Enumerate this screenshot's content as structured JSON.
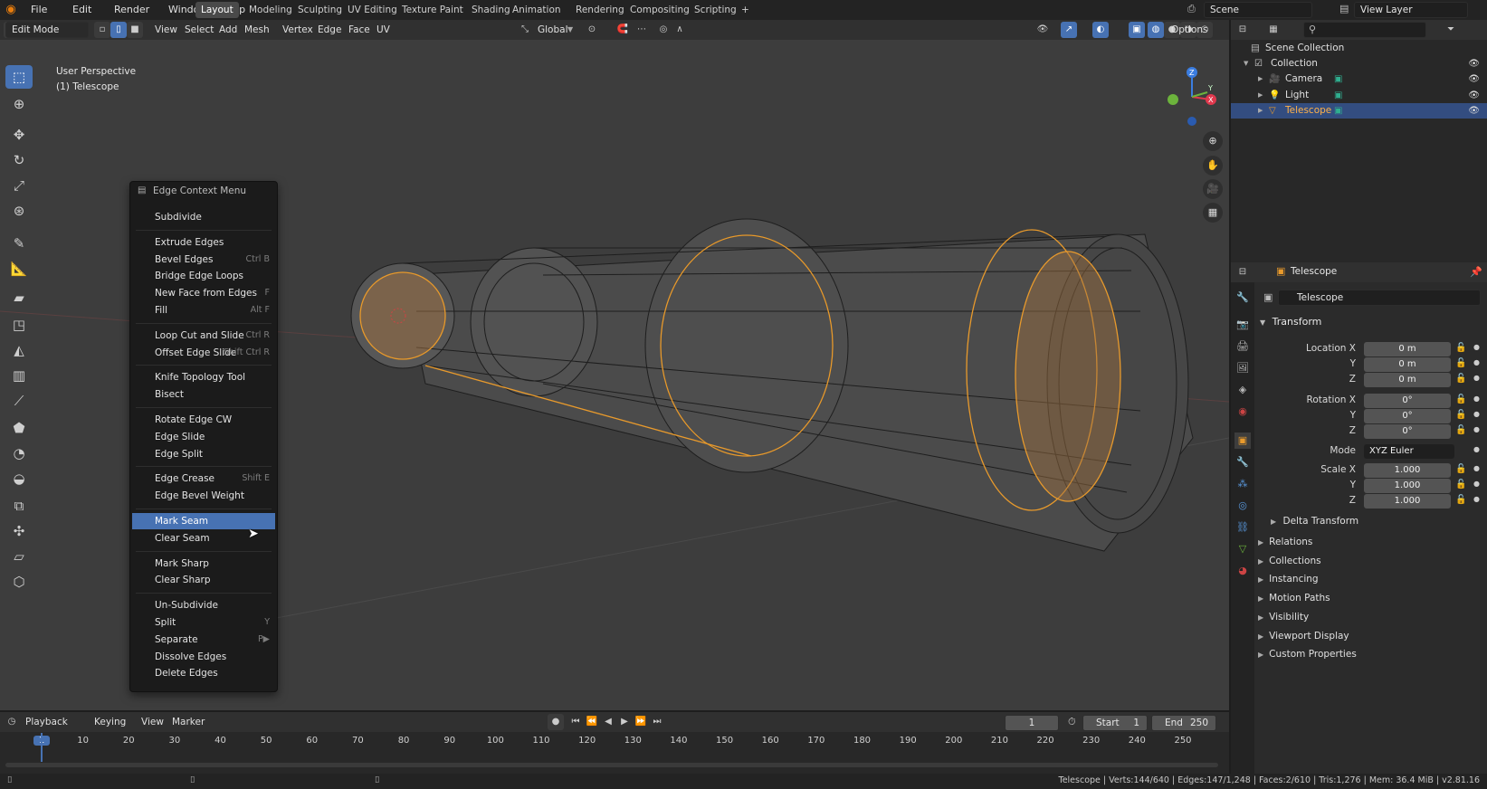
{
  "top_menu": [
    "File",
    "Edit",
    "Render",
    "Window",
    "Help"
  ],
  "workspaces": [
    "Layout",
    "Modeling",
    "Sculpting",
    "UV Editing",
    "Texture Paint",
    "Shading",
    "Animation",
    "Rendering",
    "Compositing",
    "Scripting",
    "+"
  ],
  "active_workspace": "Layout",
  "scene_field": "Scene",
  "view_layer_field": "View Layer",
  "viewport_header": {
    "mode": "Edit Mode",
    "menus": [
      "View",
      "Select",
      "Add",
      "Mesh",
      "Vertex",
      "Edge",
      "Face",
      "UV"
    ],
    "transform_orientation": "Global",
    "options": "Options"
  },
  "viewport": {
    "perspective_label": "User Perspective",
    "object_label": "(1) Telescope",
    "axes": {
      "x": "X",
      "y": "Y",
      "z": "Z"
    }
  },
  "context_menu": {
    "title": "Edge Context Menu",
    "groups": [
      [
        {
          "label": "Subdivide",
          "shortcut": ""
        }
      ],
      [
        {
          "label": "Extrude Edges",
          "shortcut": ""
        },
        {
          "label": "Bevel Edges",
          "shortcut": "Ctrl B"
        },
        {
          "label": "Bridge Edge Loops",
          "shortcut": ""
        },
        {
          "label": "New Face from Edges",
          "shortcut": "F"
        },
        {
          "label": "Fill",
          "shortcut": "Alt F"
        }
      ],
      [
        {
          "label": "Loop Cut and Slide",
          "shortcut": "Ctrl R"
        },
        {
          "label": "Offset Edge Slide",
          "shortcut": "Shift Ctrl R"
        }
      ],
      [
        {
          "label": "Knife Topology Tool",
          "shortcut": ""
        },
        {
          "label": "Bisect",
          "shortcut": ""
        }
      ],
      [
        {
          "label": "Rotate Edge CW",
          "shortcut": ""
        },
        {
          "label": "Edge Slide",
          "shortcut": ""
        },
        {
          "label": "Edge Split",
          "shortcut": ""
        }
      ],
      [
        {
          "label": "Edge Crease",
          "shortcut": "Shift E"
        },
        {
          "label": "Edge Bevel Weight",
          "shortcut": ""
        }
      ],
      [
        {
          "label": "Mark Seam",
          "shortcut": ""
        },
        {
          "label": "Clear Seam",
          "shortcut": ""
        }
      ],
      [
        {
          "label": "Mark Sharp",
          "shortcut": ""
        },
        {
          "label": "Clear Sharp",
          "shortcut": ""
        }
      ],
      [
        {
          "label": "Un-Subdivide",
          "shortcut": ""
        },
        {
          "label": "Split",
          "shortcut": "Y"
        },
        {
          "label": "Separate",
          "shortcut": "P▶"
        },
        {
          "label": "Dissolve Edges",
          "shortcut": ""
        },
        {
          "label": "Delete Edges",
          "shortcut": ""
        }
      ]
    ],
    "highlighted": "Mark Seam"
  },
  "outliner": {
    "root": "Scene Collection",
    "items": [
      {
        "label": "Collection",
        "indent": 1
      },
      {
        "label": "Camera",
        "indent": 2
      },
      {
        "label": "Light",
        "indent": 2
      },
      {
        "label": "Telescope",
        "indent": 2,
        "selected": true
      }
    ]
  },
  "properties": {
    "header_object": "Telescope",
    "object_name": "Telescope",
    "transform_title": "Transform",
    "rows": [
      {
        "label": "Location X",
        "value": "0 m"
      },
      {
        "label": "Y",
        "value": "0 m"
      },
      {
        "label": "Z",
        "value": "0 m"
      },
      {
        "label": "Rotation X",
        "value": "0°"
      },
      {
        "label": "Y",
        "value": "0°"
      },
      {
        "label": "Z",
        "value": "0°"
      },
      {
        "label": "Mode",
        "value": "XYZ Euler"
      },
      {
        "label": "Scale X",
        "value": "1.000"
      },
      {
        "label": "Y",
        "value": "1.000"
      },
      {
        "label": "Z",
        "value": "1.000"
      }
    ],
    "delta": "Delta Transform",
    "panels": [
      "Relations",
      "Collections",
      "Instancing",
      "Motion Paths",
      "Visibility",
      "Viewport Display",
      "Custom Properties"
    ]
  },
  "timeline": {
    "menus": [
      "Playback",
      "Keying",
      "View",
      "Marker"
    ],
    "current_frame": "1",
    "start_label": "Start",
    "start": "1",
    "end_label": "End",
    "end": "250",
    "ticks": [
      "1",
      "10",
      "20",
      "30",
      "40",
      "50",
      "60",
      "70",
      "80",
      "90",
      "100",
      "110",
      "120",
      "130",
      "140",
      "150",
      "160",
      "170",
      "180",
      "190",
      "200",
      "210",
      "220",
      "230",
      "240",
      "250"
    ]
  },
  "status_bar": "Telescope | Verts:144/640 | Edges:147/1,248 | Faces:2/610 | Tris:1,276 | Mem: 36.4 MiB | v2.81.16",
  "colors": {
    "accent": "#4772b3",
    "selection": "#e89a2c",
    "background": "#3d3d3d"
  }
}
